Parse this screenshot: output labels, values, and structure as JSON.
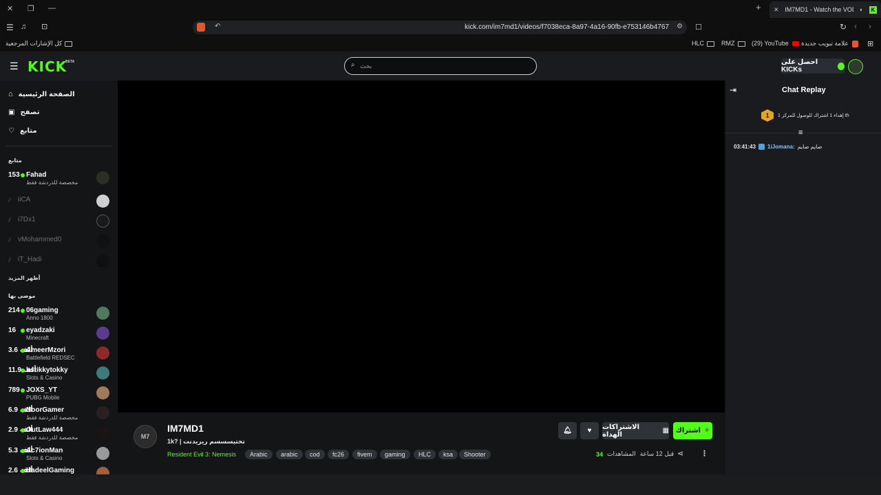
{
  "browser": {
    "tab_title": "IM7MD1 - Watch the VOD on",
    "url": "kick.com/im7md1/videos/f7038eca-8a97-4a16-90fb-e753146b4767",
    "bookmarks": [
      {
        "label": "كل الإشارات المرجعية",
        "icon": "folder-icon"
      },
      {
        "label": "HLC",
        "icon": "folder-icon"
      },
      {
        "label": "RMZ",
        "icon": "folder-icon"
      },
      {
        "label": "(29) YouTube",
        "icon": "youtube-icon"
      },
      {
        "label": "علامة تبويب جديدة",
        "icon": "brave-icon"
      }
    ]
  },
  "header": {
    "logo": "KICK",
    "beta": "BETA",
    "search_placeholder": "بحث",
    "kicks_label": "احصل على KICKs"
  },
  "sidebar": {
    "nav": [
      {
        "label": "الصفحة الرئيسية",
        "icon": "home-icon"
      },
      {
        "label": "تصفح",
        "icon": "browse-icon"
      },
      {
        "label": "متابع",
        "icon": "heart-icon"
      }
    ],
    "following_title": "متابع",
    "following": [
      {
        "name": "Fahad",
        "count": "153",
        "sub": "مخصصة للدردشة فقط",
        "live": true
      },
      {
        "name": "iiCA",
        "live": false
      },
      {
        "name": "i7Dx1",
        "live": false
      },
      {
        "name": "vMohammed0",
        "live": false
      },
      {
        "name": "iT_Hadi",
        "live": false
      }
    ],
    "show_more": "أظهر المزيد",
    "recommended_title": "موصى بها",
    "recommended": [
      {
        "name": "06gaming",
        "count": "214",
        "sub": "Anno 1800"
      },
      {
        "name": "eyadzaki",
        "count": "16",
        "sub": "Minecraft"
      },
      {
        "name": "AmeerMzori",
        "count": "3.6 ألف",
        "sub": "Battlefield REDSEC"
      },
      {
        "name": "hstikkytokky",
        "count": "11.9 ألف",
        "sub": "Slots & Casino"
      },
      {
        "name": "JOXS_YT",
        "count": "789",
        "sub": "PUBG Mobile"
      },
      {
        "name": "NoorGamer",
        "count": "6.9 ألف",
        "sub": "مخصصة للدردشة فقط"
      },
      {
        "name": "OutLaw444",
        "count": "2.9 ألف",
        "sub": "مخصصة للدردشة فقط"
      },
      {
        "name": "Ac7ionMan",
        "count": "5.3 ألف",
        "sub": "Slots & Casino"
      },
      {
        "name": "HadeelGaming",
        "count": "2.6 ألف",
        "sub": ""
      }
    ]
  },
  "stream": {
    "avatar_text": "M7",
    "streamer": "IM7MD1",
    "title": "1k? | تختيسسسم ريزيدنت",
    "category": "Resident Evil 3: Nemesis",
    "tags": [
      "Arabic",
      "arabic",
      "cod",
      "fc26",
      "fivem",
      "gaming",
      "HLC",
      "ksa",
      "Shooter"
    ],
    "subscribe_label": "اشتراك",
    "gift_label": "الاشتراكات الهداة",
    "viewers": "34",
    "viewers_label": "المشاهدات",
    "time_ago": "قبل 12 ساعة"
  },
  "chat": {
    "title": "Chat Replay",
    "pinned_rank": "1",
    "pinned_text": "إهداء 1 اشتراك للوصول للمركز 1 th",
    "messages": [
      {
        "time": "03:41:43",
        "user": "1iJomana:",
        "text": "صايم صايم"
      }
    ]
  },
  "colors": {
    "accent": "#53fc18",
    "background": "#141517",
    "chat_bg": "#191b1f"
  }
}
